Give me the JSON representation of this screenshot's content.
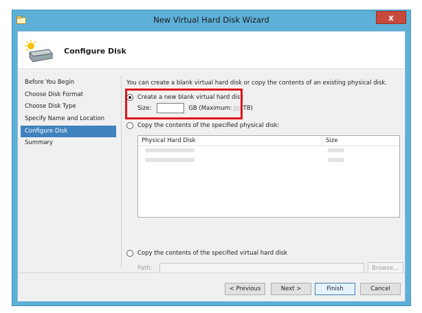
{
  "window": {
    "title": "New Virtual Hard Disk Wizard",
    "close_glyph": "x"
  },
  "header": {
    "title": "Configure Disk",
    "icon": "disk-icon"
  },
  "nav": {
    "items": [
      {
        "label": "Before You Begin",
        "selected": false
      },
      {
        "label": "Choose Disk Format",
        "selected": false
      },
      {
        "label": "Choose Disk Type",
        "selected": false
      },
      {
        "label": "Specify Name and Location",
        "selected": false
      },
      {
        "label": "Configure Disk",
        "selected": true
      },
      {
        "label": "Summary",
        "selected": false
      }
    ]
  },
  "content": {
    "description": "You can create a blank virtual hard disk or copy the contents of an existing physical disk.",
    "option_new": {
      "label": "Create a new blank virtual hard disk",
      "checked": true
    },
    "size": {
      "label": "Size:",
      "value": "",
      "unit": "GB (Maximum:",
      "unit_suffix": "TB)"
    },
    "option_physical": {
      "label": "Copy the contents of the specified physical disk:",
      "checked": false
    },
    "table": {
      "headers": [
        "Physical Hard Disk",
        "Size"
      ]
    },
    "option_virtual": {
      "label": "Copy the contents of the specified virtual hard disk",
      "checked": false
    },
    "path": {
      "label": "Path:",
      "value": ""
    },
    "browse_label": "Browse..."
  },
  "footer": {
    "previous_label": "< Previous",
    "next_label": "Next >",
    "finish_label": "Finish",
    "cancel_label": "Cancel"
  },
  "colors": {
    "title_bar": "#5db0d7",
    "nav_selected": "#3f82be",
    "highlight": "#e0141c"
  }
}
